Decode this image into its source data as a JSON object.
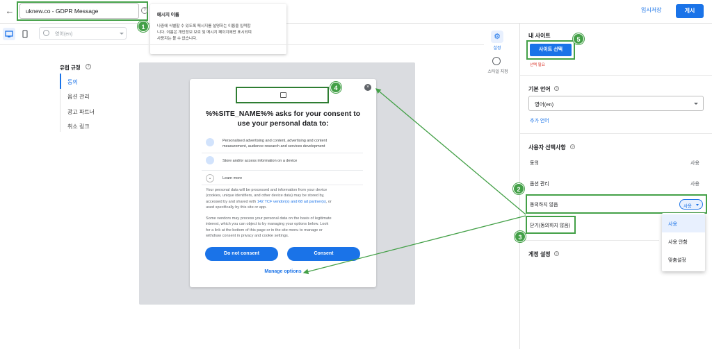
{
  "header": {
    "message_name": "uknew.co - GDPR Message",
    "save_draft": "임시저장",
    "publish": "게시"
  },
  "tooltip": {
    "title": "메시지 이름",
    "body_line1": "나중에 식별할 수 있도록 메시지를 설명하는 이름을 입력합",
    "body_line2": "니다. 이름은 개인정보 보호 및 메시지 페이지에만 표시되며",
    "body_line3": "사용자는 볼 수 없습니다."
  },
  "toolbar": {
    "language": "영어(en)"
  },
  "left_nav": {
    "title": "유럽 규정",
    "items": [
      {
        "label": "동의"
      },
      {
        "label": "옵션 관리"
      },
      {
        "label": "광고 파트너"
      },
      {
        "label": "취소 링크"
      }
    ]
  },
  "dialog": {
    "title": "%%SITE_NAME%% asks for your consent to use your personal data to:",
    "purpose1_line1": "Personalised advertising and content, advertising and content",
    "purpose1_line2": "measurement, audience research and services development",
    "purpose2": "Store and/or access information on a device",
    "learn_more": "Learn more",
    "para1_line1": "Your personal data will be processed and information from your device",
    "para1_line2": "(cookies, unique identifiers, and other device data) may be stored by,",
    "para1_line3_pre": "accessed by and shared with ",
    "para1_link": "142 TCF vendor(s) and 68 ad partner(s)",
    "para1_line3_post": ", or",
    "para1_line4": "used specifically by this site or app.",
    "para2_line1": "Some vendors may process your personal data on the basis of legitimate",
    "para2_line2": "interest, which you can object to by managing your options below. Look",
    "para2_line3": "for a link at the bottom of this page or in the site menu to manage or",
    "para2_line4": "withdraw consent in privacy and cookie settings.",
    "do_not_consent": "Do not consent",
    "consent": "Consent",
    "manage_options": "Manage options"
  },
  "right_tabs": {
    "settings": "설정",
    "style": "스타일 지정"
  },
  "right_panel": {
    "my_site": "내 사이트",
    "select_site": "사이트 선택",
    "required": "선택 필요",
    "default_language": "기본 언어",
    "language_value": "영어(en)",
    "add_language": "추가 언어",
    "user_choices": "사용자 선택사항",
    "rows": [
      {
        "label": "동의",
        "value": "사용"
      },
      {
        "label": "옵션 관리",
        "value": "사용"
      },
      {
        "label": "동의하지 않음",
        "value": "사용"
      },
      {
        "label": "닫기(동의하지 않음)",
        "value": ""
      }
    ],
    "account_settings": "게정 설정",
    "menu": [
      "사용",
      "사용 안함",
      "맞춤설정"
    ]
  },
  "callouts": [
    "1",
    "2",
    "3",
    "4",
    "5"
  ],
  "colors": {
    "accent": "#1a73e8",
    "highlight": "#43a047"
  }
}
